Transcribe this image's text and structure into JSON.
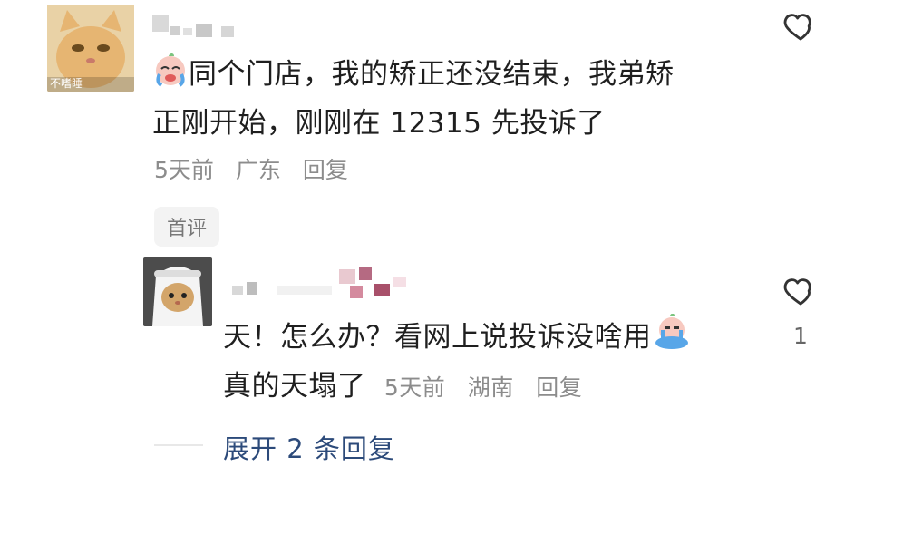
{
  "comment1": {
    "avatar": {
      "overlay_text": "不嗜睡"
    },
    "text": "同个门店，我的矫正还没结束，我弟矫正刚开始，刚刚在 12315 先投诉了",
    "line1": "同个门店，我的矫正还没结束，我弟矫",
    "line2": "正刚开始，刚刚在 12315 先投诉了",
    "time": "5天前",
    "location": "广东",
    "reply_label": "回复",
    "tag": "首评",
    "like_icon": "heart-icon"
  },
  "reply1": {
    "text": "天！怎么办？看网上说投诉没啥用",
    "line2": "真的天塌了",
    "time": "5天前",
    "location": "湖南",
    "reply_label": "回复",
    "like_count": "1",
    "like_icon": "heart-icon"
  },
  "expand": {
    "label": "展开 2 条回复"
  },
  "colors": {
    "link": "#2c4a7a",
    "meta": "#8c8c8c",
    "tag_bg": "#f3f3f3"
  }
}
